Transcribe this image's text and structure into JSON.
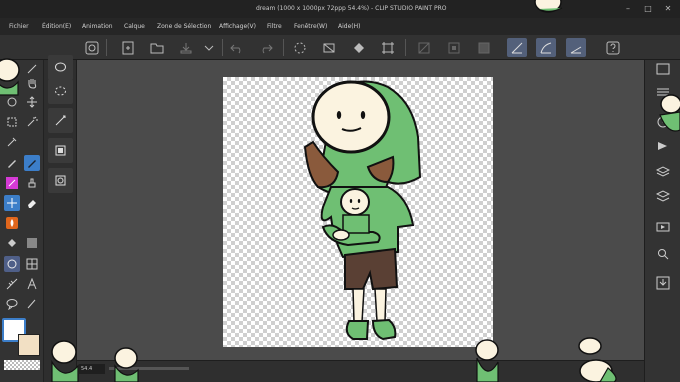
{
  "window": {
    "title": "dream (1000 x 1000px 72ppp 54.4%) - CLIP STUDIO PAINT PRO",
    "controls": [
      "–",
      "□",
      "✕"
    ]
  },
  "menu": {
    "items": [
      "Fichier",
      "Édition(E)",
      "Animation",
      "Calque",
      "Zone de Sélection",
      "Affichage(V)",
      "Filtre",
      "Fenêtre(W)",
      "Aide(H)"
    ]
  },
  "command_bar": {
    "icons": [
      "clip-studio-icon",
      "new-document-icon",
      "open-icon",
      "save-icon",
      "export-dropdown-icon",
      "undo-icon",
      "redo-icon",
      "loading-icon",
      "clear-icon",
      "fill-icon",
      "transform-icon",
      "deselect-icon",
      "invert-selection-icon",
      "select-all-icon",
      "pen-stabilizer-1-icon",
      "pen-stabilizer-2-icon",
      "pen-stabilizer-3-icon",
      "help-icon"
    ]
  },
  "colors": {
    "accent": "#3c7ec9",
    "highlight": "#53607a",
    "main_color": "#ffffff",
    "sub_color": "#f2e0c4"
  },
  "status": {
    "zoom": "54.4"
  }
}
